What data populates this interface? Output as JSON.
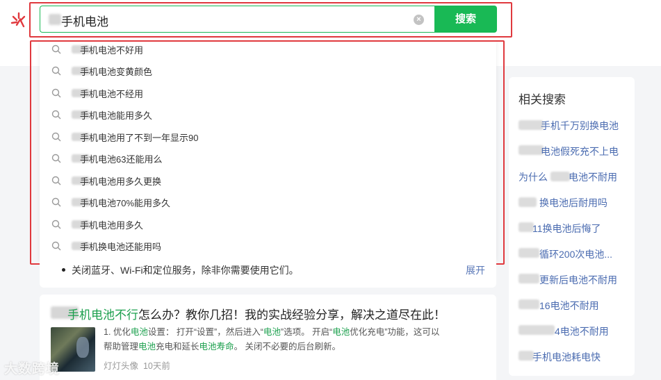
{
  "search": {
    "query": "手机电池",
    "clear_icon": "clear-icon",
    "button_label": "搜索",
    "brand_color": "#19b955",
    "highlight_color": "#e0393e"
  },
  "suggestions": [
    "手机电池不好用",
    "手机电池变黄颜色",
    "手机电池不经用",
    "手机电池能用多久",
    "手机电池用了不到一年显示90",
    "手机电池63还能用么",
    "手机电池用多久更换",
    "手机电池70%能用多久",
    "手机电池用多久",
    "手机换电池还能用吗"
  ],
  "result1": {
    "bullet": "关闭蓝牙、Wi-Fi和定位服务，除非你需要使用它们。",
    "expand": "展开"
  },
  "result2": {
    "title_hl": "手机电池不行",
    "title_rest": "怎么办？教你几招！我的实战经验分享，解决之道尽在此！",
    "s1": "1. 优化",
    "s2": "电池",
    "s3": "设置： 打开“设置”，然后进入“",
    "s4": "电池",
    "s5": "”选项。 开启“",
    "s6": "电池",
    "s7": "优化充电”功能，这可以",
    "s8": "帮助管理",
    "s9": "电池",
    "s10": "充电和延长",
    "s11": "电池寿命",
    "s12": "。 关闭不必要的后台刷新。",
    "author": "灯灯头像",
    "time": "10天前"
  },
  "related": {
    "title": "相关搜索",
    "items": [
      "手机千万别换电池",
      "电池假死充不上电",
      "为什么",
      "换电池后耐用吗",
      "11换电池后悔了",
      "循环200次电池...",
      "更新后电池不耐用",
      "16电池不耐用",
      "4电池不耐用",
      "手机电池耗电快"
    ],
    "item3_tail": "电池不耐用"
  },
  "watermark": "大数跨境"
}
